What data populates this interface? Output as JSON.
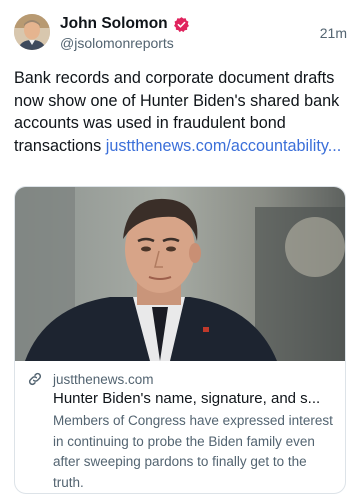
{
  "author": {
    "name": "John Solomon",
    "handle": "@jsolomonreports",
    "time": "21m"
  },
  "post": {
    "text": "Bank records and corporate document drafts now show one of Hunter Biden's shared bank accounts was used in fraudulent bond transactions",
    "link_text": "justthenews.com/accountability..."
  },
  "card": {
    "domain": "justthenews.com",
    "title": "Hunter Biden's name, signature, and s...",
    "description": "Members of Congress have expressed interest in continuing to probe the Biden family even after sweeping pardons to finally get to the truth."
  },
  "icons": {
    "verified": "verified-badge-icon",
    "link": "link-icon"
  },
  "colors": {
    "verified_badge": "#e0245e",
    "link": "#3b6fd9",
    "secondary_text": "#536471"
  }
}
